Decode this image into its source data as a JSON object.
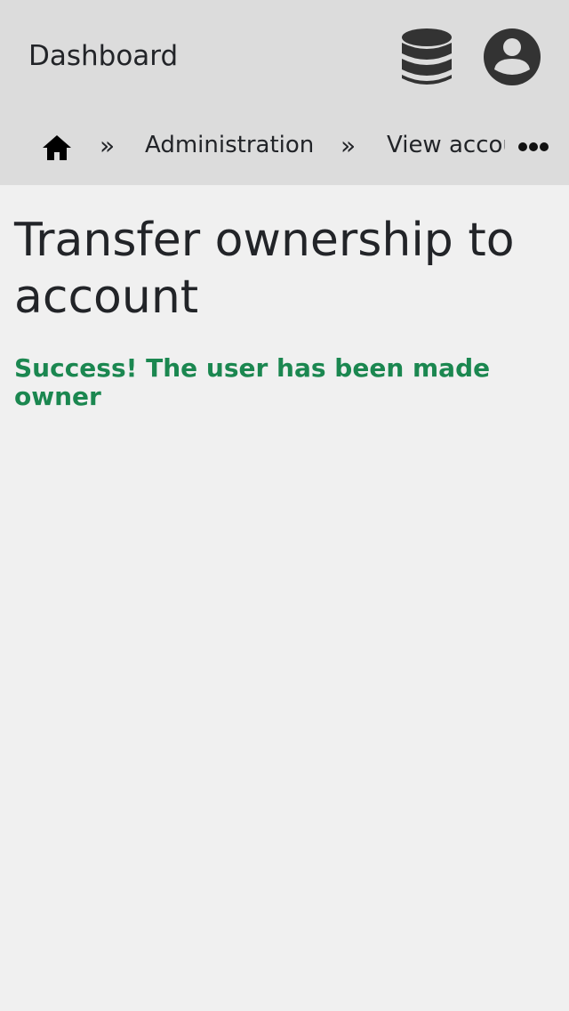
{
  "header": {
    "dashboard_label": "Dashboard",
    "icons": [
      "database-icon",
      "user-account-icon"
    ]
  },
  "breadcrumb": {
    "home_icon": "home-icon",
    "separator": "»",
    "items": [
      {
        "label": "Administration"
      },
      {
        "label": "View account"
      }
    ],
    "more_icon": "more-horizontal-icon"
  },
  "main": {
    "title": "Transfer ownership to account",
    "success_message": "Success! The user has been made owner"
  },
  "colors": {
    "header_bg": "#dcdcdc",
    "page_bg": "#f0f0f0",
    "text": "#222428",
    "icon": "#333333",
    "success": "#1b8750"
  }
}
